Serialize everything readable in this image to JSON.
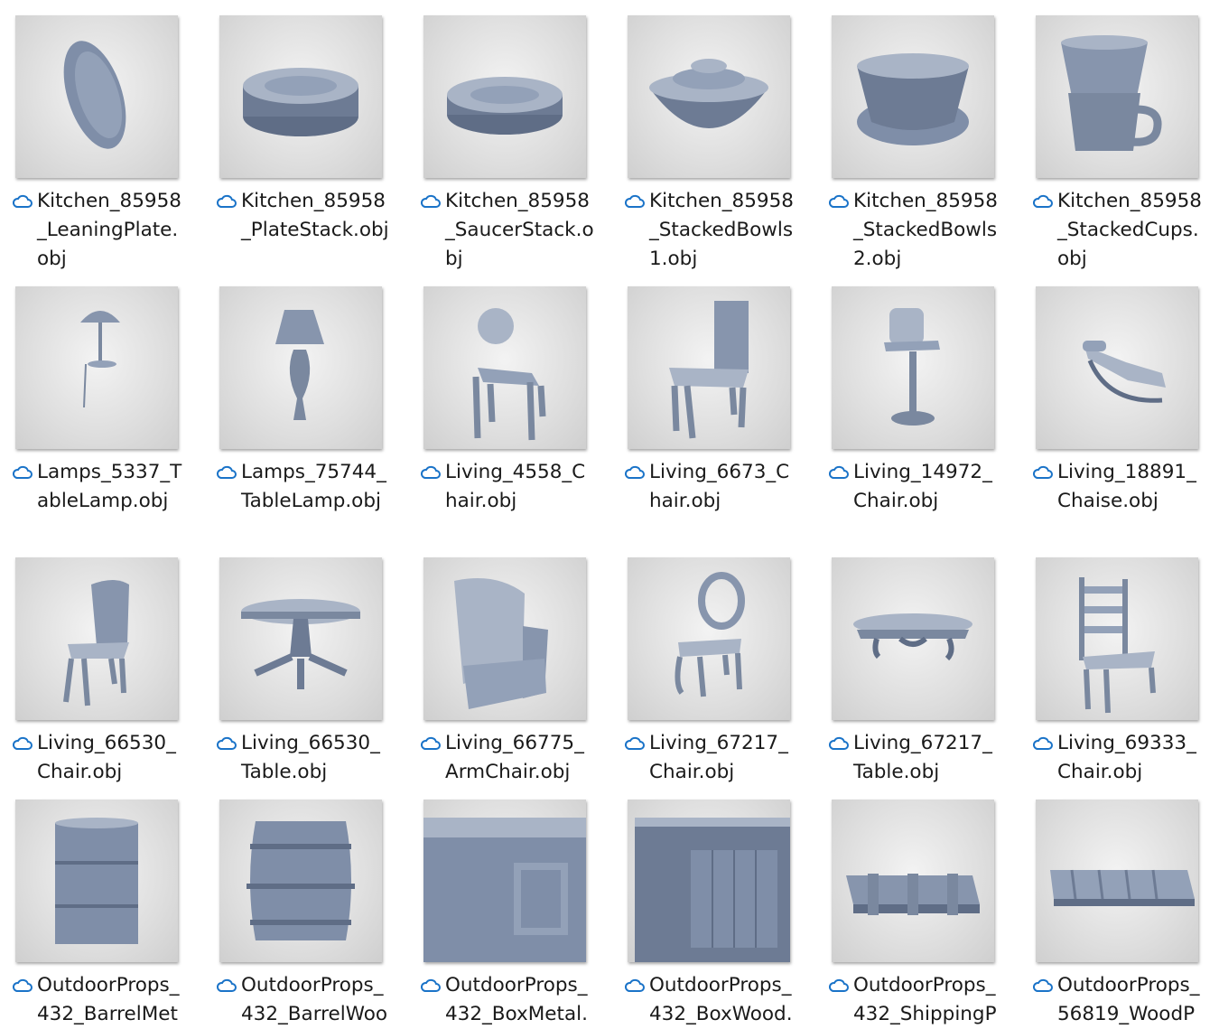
{
  "colors": {
    "cloud_icon": "#1a73c8",
    "model_fill": "#8795ad",
    "model_dark": "#5f6d86",
    "model_light": "#a9b4c6"
  },
  "files": [
    {
      "name": "Kitchen_85958_LeaningPlate.obj",
      "icon": "cloud-icon"
    },
    {
      "name": "Kitchen_85958_PlateStack.obj",
      "icon": "cloud-icon"
    },
    {
      "name": "Kitchen_85958_SaucerStack.obj",
      "icon": "cloud-icon"
    },
    {
      "name": "Kitchen_85958_StackedBowls1.obj",
      "icon": "cloud-icon"
    },
    {
      "name": "Kitchen_85958_StackedBowls2.obj",
      "icon": "cloud-icon"
    },
    {
      "name": "Kitchen_85958_StackedCups.obj",
      "icon": "cloud-icon"
    },
    {
      "name": "Lamps_5337_TableLamp.obj",
      "icon": "cloud-icon"
    },
    {
      "name": "Lamps_75744_TableLamp.obj",
      "icon": "cloud-icon"
    },
    {
      "name": "Living_4558_Chair.obj",
      "icon": "cloud-icon"
    },
    {
      "name": "Living_6673_Chair.obj",
      "icon": "cloud-icon"
    },
    {
      "name": "Living_14972_Chair.obj",
      "icon": "cloud-icon"
    },
    {
      "name": "Living_18891_Chaise.obj",
      "icon": "cloud-icon"
    },
    {
      "name": "Living_66530_Chair.obj",
      "icon": "cloud-icon"
    },
    {
      "name": "Living_66530_Table.obj",
      "icon": "cloud-icon"
    },
    {
      "name": "Living_66775_ArmChair.obj",
      "icon": "cloud-icon"
    },
    {
      "name": "Living_67217_Chair.obj",
      "icon": "cloud-icon"
    },
    {
      "name": "Living_67217_Table.obj",
      "icon": "cloud-icon"
    },
    {
      "name": "Living_69333_Chair.obj",
      "icon": "cloud-icon"
    },
    {
      "name": "OutdoorProps_432_BarrelMet",
      "icon": "cloud-icon"
    },
    {
      "name": "OutdoorProps_432_BarrelWoo",
      "icon": "cloud-icon"
    },
    {
      "name": "OutdoorProps_432_BoxMetal.",
      "icon": "cloud-icon"
    },
    {
      "name": "OutdoorProps_432_BoxWood.",
      "icon": "cloud-icon"
    },
    {
      "name": "OutdoorProps_432_ShippingP",
      "icon": "cloud-icon"
    },
    {
      "name": "OutdoorProps_56819_WoodP",
      "icon": "cloud-icon"
    }
  ]
}
